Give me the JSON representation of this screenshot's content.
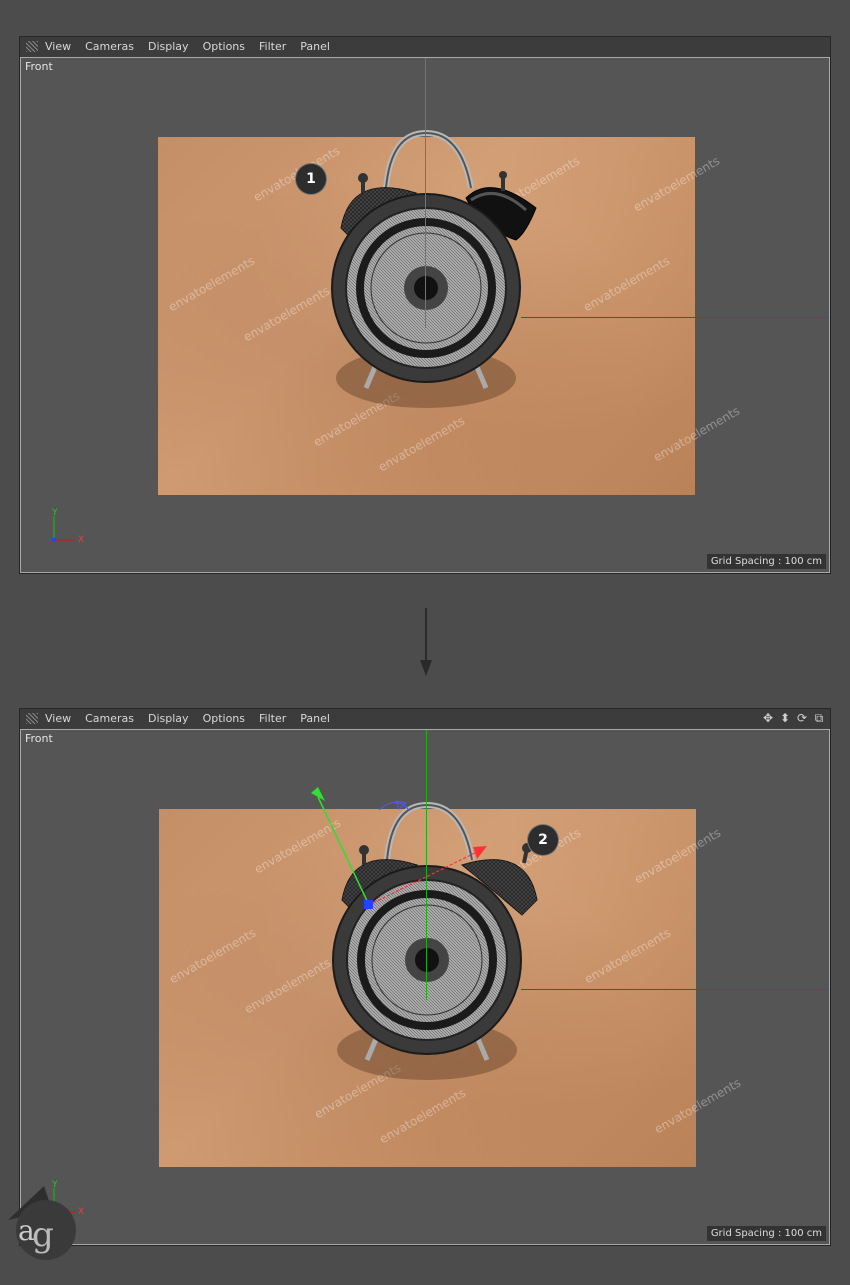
{
  "top": {
    "menu": [
      "View",
      "Cameras",
      "Display",
      "Options",
      "Filter",
      "Panel"
    ],
    "view_label": "Front",
    "grid_spacing": "Grid Spacing : 100 cm",
    "badge": "1"
  },
  "bottom": {
    "menu": [
      "View",
      "Cameras",
      "Display",
      "Options",
      "Filter",
      "Panel"
    ],
    "view_label": "Front",
    "grid_spacing": "Grid Spacing : 100 cm",
    "badge": "2",
    "nav_icons": [
      "move-icon",
      "pan-icon",
      "rotate-icon",
      "maximize-icon"
    ]
  },
  "watermark": "envatoelements",
  "axis": {
    "x": "X",
    "y": "Y"
  },
  "colors": {
    "x_axis": "#c02020",
    "y_axis": "#22aa22",
    "z_axis": "#2244ff",
    "paper": "#c8926a"
  }
}
